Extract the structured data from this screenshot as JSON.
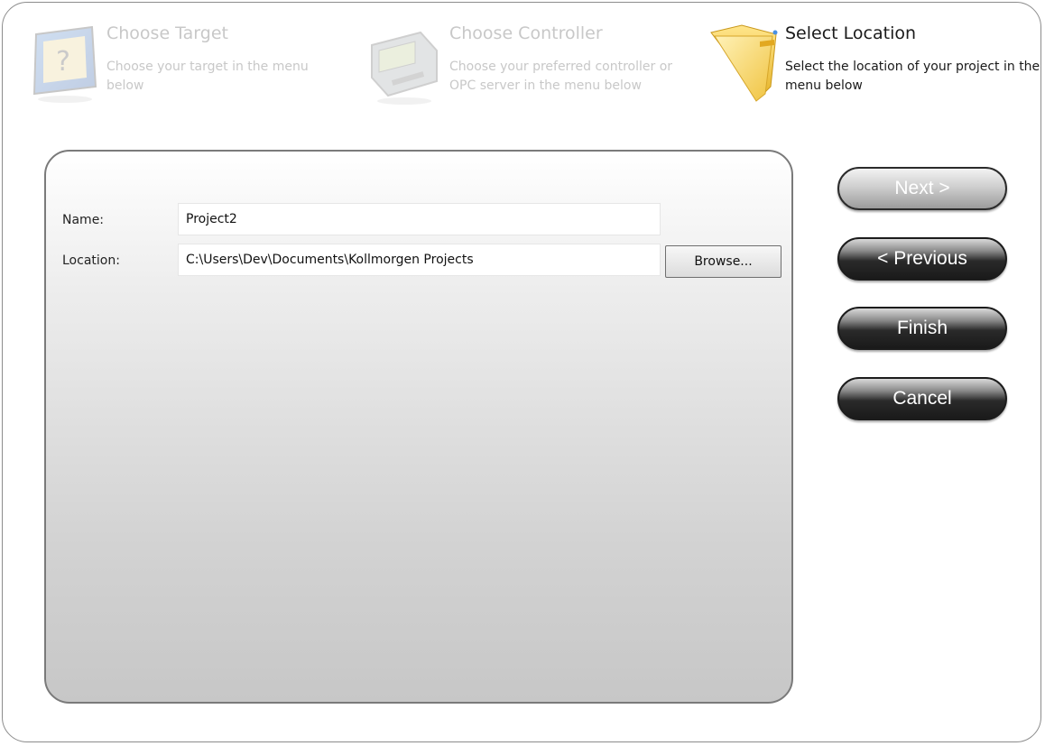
{
  "steps": [
    {
      "title": "Choose Target",
      "desc": "Choose your target in the menu below",
      "icon": "target-icon",
      "state": "inactive"
    },
    {
      "title": "Choose Controller",
      "desc": "Choose your preferred controller or OPC server in the menu below",
      "icon": "controller-icon",
      "state": "inactive"
    },
    {
      "title": "Select Location",
      "desc": "Select the location of your project in the menu below",
      "icon": "folder-icon",
      "state": "active"
    }
  ],
  "form": {
    "name_label": "Name:",
    "name_value": "Project2",
    "location_label": "Location:",
    "location_value": "C:\\Users\\Dev\\Documents\\Kollmorgen Projects",
    "browse_label": "Browse..."
  },
  "buttons": {
    "next": "Next >",
    "previous": "< Previous",
    "finish": "Finish",
    "cancel": "Cancel"
  },
  "states": {
    "next_enabled": false,
    "previous_enabled": true,
    "finish_enabled": true,
    "cancel_enabled": true
  }
}
